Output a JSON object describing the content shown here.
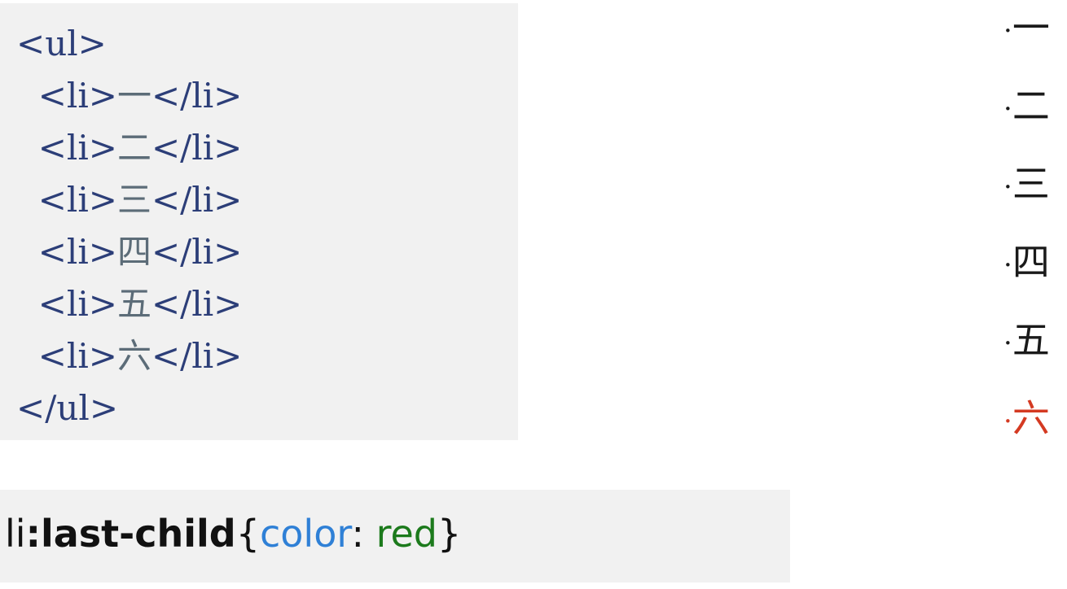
{
  "html_code": {
    "open_tag": "<ul>",
    "items": [
      {
        "open": "  <li>",
        "text": "一",
        "close": "</li>"
      },
      {
        "open": "  <li>",
        "text": "二",
        "close": "</li>"
      },
      {
        "open": "  <li>",
        "text": "三",
        "close": "</li>"
      },
      {
        "open": "  <li>",
        "text": "四",
        "close": "</li>"
      },
      {
        "open": "  <li>",
        "text": "五",
        "close": "</li>"
      },
      {
        "open": "  <li>",
        "text": "六",
        "close": "</li>"
      }
    ],
    "close_tag": "</ul>"
  },
  "rendered_output": {
    "bullet": "·",
    "items": [
      "一",
      "二",
      "三",
      "四",
      "五",
      "六"
    ],
    "highlight_color": "#d43a22",
    "text_color": "#1a1a1a"
  },
  "css_rule": {
    "selector": "li",
    "pseudo": ":last-child",
    "open_brace": "{",
    "property": "color",
    "colon": ": ",
    "value": "red",
    "close_brace": "}"
  },
  "colors": {
    "code_tag": "#2c3e78",
    "property": "#2f80d6",
    "value": "#1c7a1c",
    "box_bg": "#f1f1f1"
  }
}
